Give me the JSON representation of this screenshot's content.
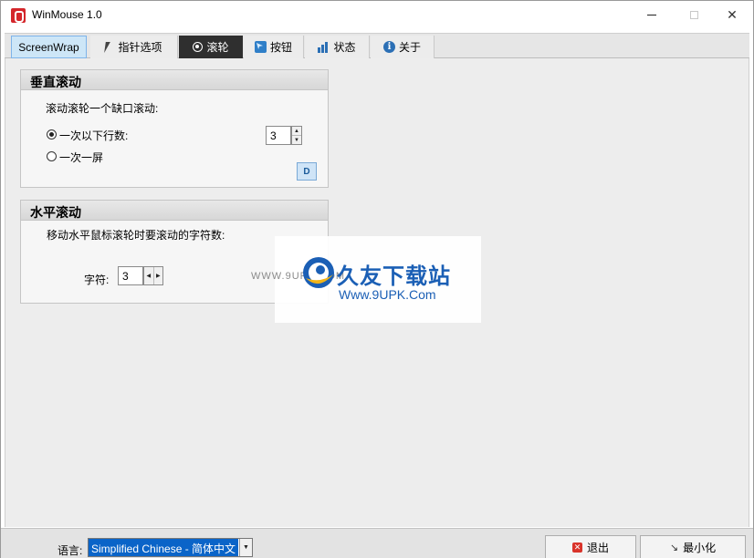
{
  "window": {
    "title": "WinMouse 1.0"
  },
  "tabs": [
    {
      "label": "ScreenWrap"
    },
    {
      "label": "指针选项"
    },
    {
      "label": "滚轮"
    },
    {
      "label": "按钮"
    },
    {
      "label": "状态"
    },
    {
      "label": "关于"
    }
  ],
  "vertical_scroll": {
    "heading": "垂直滚动",
    "description": "滚动滚轮一个缺口滚动:",
    "option_lines": "一次以下行数:",
    "option_screen": "一次一屏",
    "lines_value": "3",
    "d_button": "D"
  },
  "horizontal_scroll": {
    "heading": "水平滚动",
    "description": "移动水平鼠标滚轮时要滚动的字符数:",
    "chars_label": "字符:",
    "chars_value": "3"
  },
  "watermark": {
    "small": "WWW.9UPK.COM",
    "title": "久友下载站",
    "url": "Www.9UPK.Com"
  },
  "bottom": {
    "language_label": "语言:",
    "language_value": "Simplified Chinese - 简体中文",
    "exit_label": "退出",
    "minimize_label": "最小化"
  },
  "colors": {
    "active_tab": "#2f2f2f",
    "screenwrap_tab": "#cde6f7",
    "selection": "#0a64c8",
    "brand_red": "#d4262b",
    "watermark_blue": "#1b5fb5"
  }
}
